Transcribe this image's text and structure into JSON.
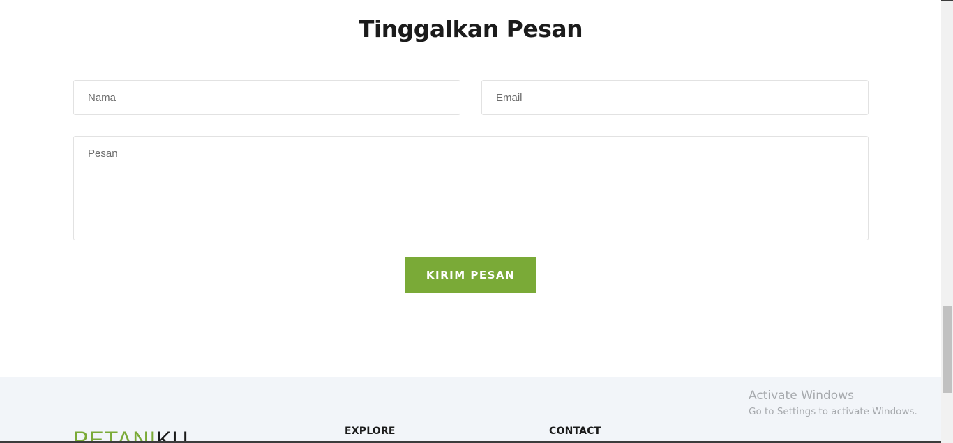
{
  "section": {
    "title": "Tinggalkan Pesan"
  },
  "form": {
    "name_placeholder": "Nama",
    "email_placeholder": "Email",
    "message_placeholder": "Pesan",
    "submit_label": "KIRIM PESAN"
  },
  "footer": {
    "logo_part1": "PETANI",
    "logo_part2": "KU",
    "explore_heading": "EXPLORE",
    "contact_heading": "CONTACT"
  },
  "watermark": {
    "title": "Activate Windows",
    "subtitle": "Go to Settings to activate Windows."
  },
  "colors": {
    "accent": "#7aaa37",
    "footer_bg": "#f2f5f9",
    "text_dark": "#1b1b1b"
  }
}
